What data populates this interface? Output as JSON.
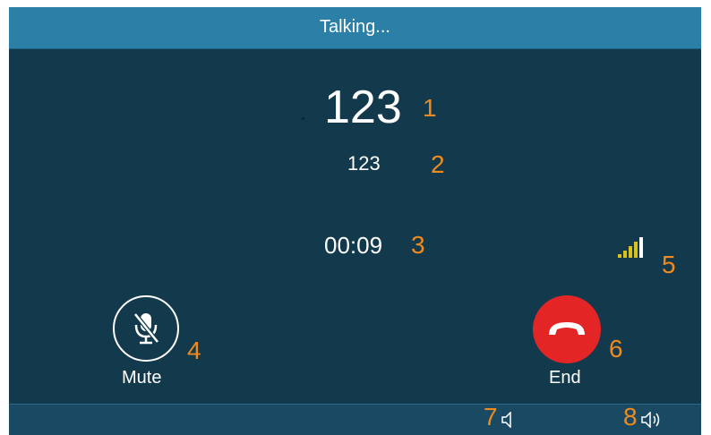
{
  "title_bar": {
    "status": "Talking..."
  },
  "call": {
    "caller_number": "123",
    "caller_name": "123",
    "duration": "00:09",
    "signal_strength": "4 of 5"
  },
  "buttons": {
    "mute_label": "Mute",
    "end_label": "End"
  },
  "soft_keys": [
    {
      "icon": "speaker-low-icon"
    },
    {
      "icon": "speaker-high-icon"
    }
  ],
  "annotations": [
    "1",
    "2",
    "3",
    "4",
    "5",
    "6",
    "7",
    "8"
  ],
  "colors": {
    "title_bar": "#2c7fa6",
    "screen_bg": "#123a4c",
    "annotation": "#f08a1c",
    "end_button": "#e42526",
    "signal": "#d9c21b"
  }
}
